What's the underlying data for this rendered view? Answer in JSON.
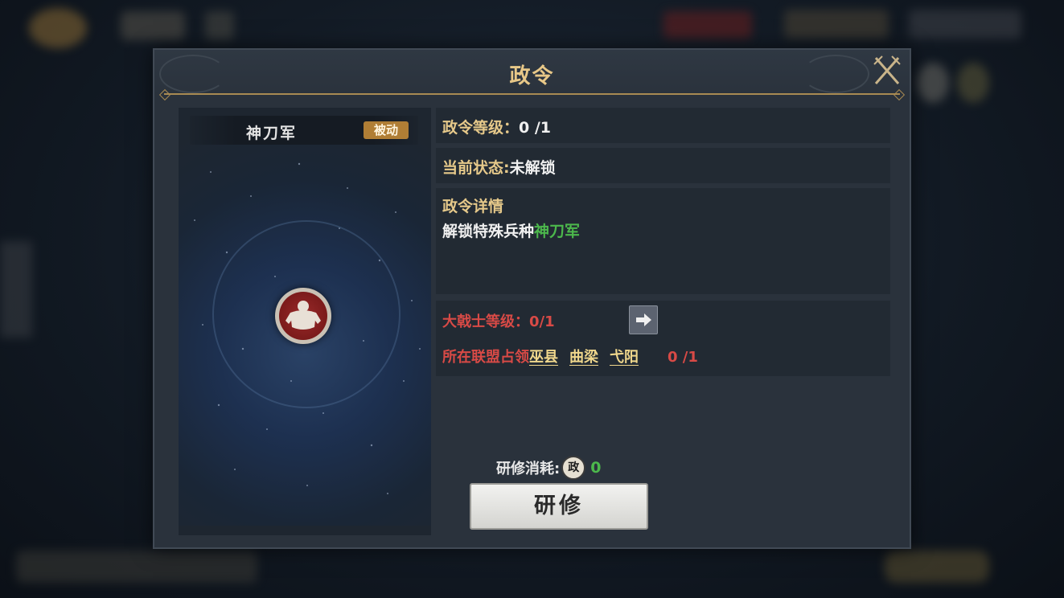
{
  "dialog": {
    "title": "政令"
  },
  "unit": {
    "name": "神刀军",
    "badge": "被动"
  },
  "level": {
    "label": "政令等级：",
    "value": "0 /1"
  },
  "state": {
    "label": "当前状态:",
    "value": "未解锁"
  },
  "detail": {
    "heading": "政令详情",
    "text_prefix": "解锁特殊兵种",
    "text_highlight": "神刀军"
  },
  "requirements": {
    "rank_label": "大戟士等级：",
    "rank_value": "0/1",
    "alliance_label": "所在联盟占领",
    "cities": [
      "巫县",
      "曲梁",
      "弋阳"
    ],
    "alliance_progress": "0 /1"
  },
  "cost": {
    "label": "研修消耗:",
    "icon_char": "政",
    "value": "0"
  },
  "study_button": {
    "label": "研修"
  },
  "colors": {
    "accent_gold": "#e6c98a",
    "requirement_red": "#d84a46",
    "highlight_green": "#4cb84c",
    "badge_bronze": "#b07e35"
  }
}
